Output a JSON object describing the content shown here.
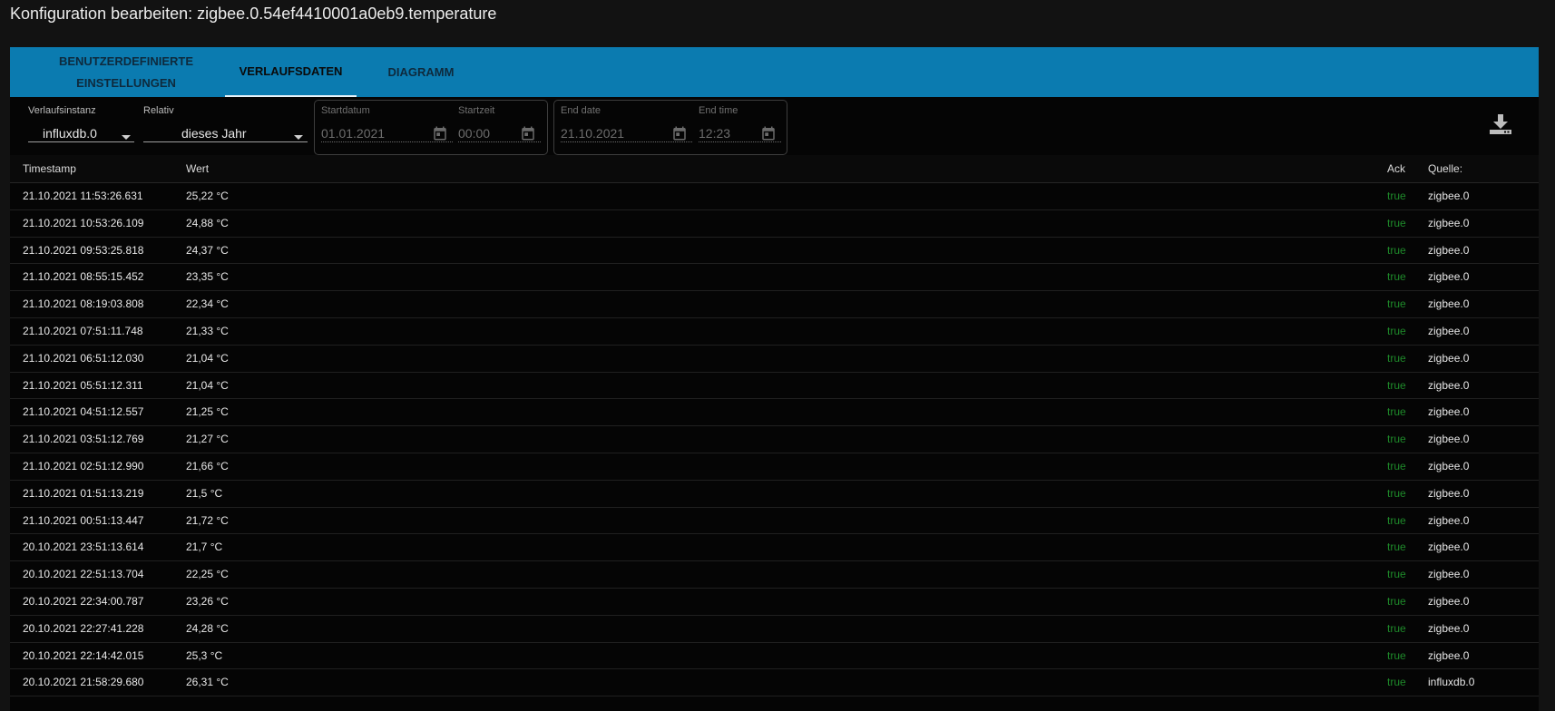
{
  "window": {
    "title": "Konfiguration bearbeiten: zigbee.0.54ef4410001a0eb9.temperature"
  },
  "tabs": [
    {
      "label_line1": "BENUTZERDEFINIERTE",
      "label_line2": "EINSTELLUNGEN",
      "active": false
    },
    {
      "label": "VERLAUFSDATEN",
      "active": true
    },
    {
      "label": "DIAGRAMM",
      "active": false
    }
  ],
  "filters": {
    "instance": {
      "label": "Verlaufsinstanz",
      "value": "influxdb.0"
    },
    "relative": {
      "label": "Relativ",
      "value": "dieses Jahr"
    },
    "start_date": {
      "label": "Startdatum",
      "value": "01.01.2021"
    },
    "start_time": {
      "label": "Startzeit",
      "value": "00:00"
    },
    "end_date": {
      "label": "End date",
      "value": "21.10.2021"
    },
    "end_time": {
      "label": "End time",
      "value": "12:23"
    }
  },
  "icons": {
    "download": "download-icon",
    "calendar": "calendar-icon",
    "dropdown": "chevron-down-icon"
  },
  "colors": {
    "tabbar": "#0b7bb0",
    "ack_true": "#1e8a2a",
    "background": "#050505"
  },
  "table": {
    "columns": {
      "timestamp": "Timestamp",
      "value": "Wert",
      "ack": "Ack",
      "source": "Quelle:"
    },
    "rows": [
      {
        "ts": "21.10.2021 11:53:26.631",
        "val": "25,22 °C",
        "ack": "true",
        "src": "zigbee.0"
      },
      {
        "ts": "21.10.2021 10:53:26.109",
        "val": "24,88 °C",
        "ack": "true",
        "src": "zigbee.0"
      },
      {
        "ts": "21.10.2021 09:53:25.818",
        "val": "24,37 °C",
        "ack": "true",
        "src": "zigbee.0"
      },
      {
        "ts": "21.10.2021 08:55:15.452",
        "val": "23,35 °C",
        "ack": "true",
        "src": "zigbee.0"
      },
      {
        "ts": "21.10.2021 08:19:03.808",
        "val": "22,34 °C",
        "ack": "true",
        "src": "zigbee.0"
      },
      {
        "ts": "21.10.2021 07:51:11.748",
        "val": "21,33 °C",
        "ack": "true",
        "src": "zigbee.0"
      },
      {
        "ts": "21.10.2021 06:51:12.030",
        "val": "21,04 °C",
        "ack": "true",
        "src": "zigbee.0"
      },
      {
        "ts": "21.10.2021 05:51:12.311",
        "val": "21,04 °C",
        "ack": "true",
        "src": "zigbee.0"
      },
      {
        "ts": "21.10.2021 04:51:12.557",
        "val": "21,25 °C",
        "ack": "true",
        "src": "zigbee.0"
      },
      {
        "ts": "21.10.2021 03:51:12.769",
        "val": "21,27 °C",
        "ack": "true",
        "src": "zigbee.0"
      },
      {
        "ts": "21.10.2021 02:51:12.990",
        "val": "21,66 °C",
        "ack": "true",
        "src": "zigbee.0"
      },
      {
        "ts": "21.10.2021 01:51:13.219",
        "val": "21,5 °C",
        "ack": "true",
        "src": "zigbee.0"
      },
      {
        "ts": "21.10.2021 00:51:13.447",
        "val": "21,72 °C",
        "ack": "true",
        "src": "zigbee.0"
      },
      {
        "ts": "20.10.2021 23:51:13.614",
        "val": "21,7 °C",
        "ack": "true",
        "src": "zigbee.0"
      },
      {
        "ts": "20.10.2021 22:51:13.704",
        "val": "22,25 °C",
        "ack": "true",
        "src": "zigbee.0"
      },
      {
        "ts": "20.10.2021 22:34:00.787",
        "val": "23,26 °C",
        "ack": "true",
        "src": "zigbee.0"
      },
      {
        "ts": "20.10.2021 22:27:41.228",
        "val": "24,28 °C",
        "ack": "true",
        "src": "zigbee.0"
      },
      {
        "ts": "20.10.2021 22:14:42.015",
        "val": "25,3 °C",
        "ack": "true",
        "src": "zigbee.0"
      },
      {
        "ts": "20.10.2021 21:58:29.680",
        "val": "26,31 °C",
        "ack": "true",
        "src": "influxdb.0"
      }
    ]
  }
}
